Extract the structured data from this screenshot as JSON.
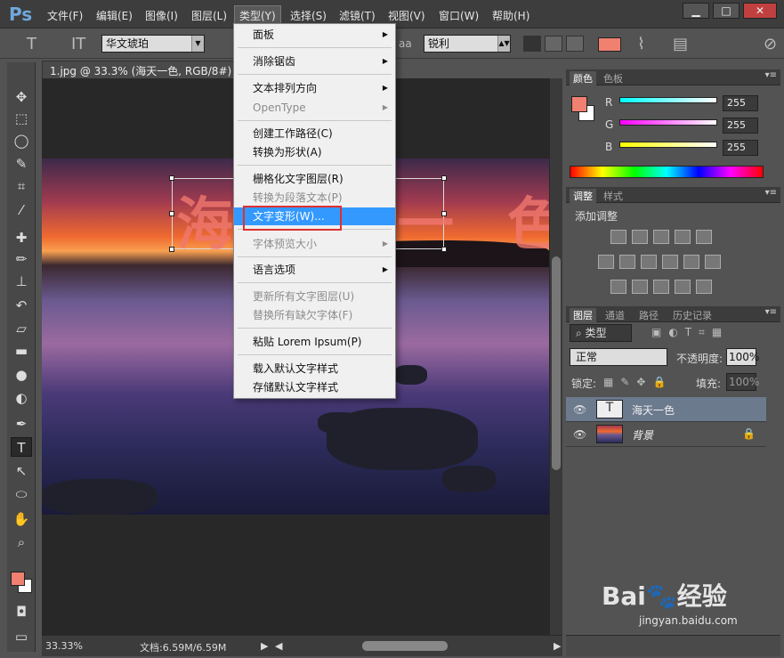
{
  "app": {
    "logo": "Ps"
  },
  "menubar": {
    "items": [
      "文件(F)",
      "编辑(E)",
      "图像(I)",
      "图层(L)",
      "类型(Y)",
      "选择(S)",
      "滤镜(T)",
      "视图(V)",
      "窗口(W)",
      "帮助(H)"
    ],
    "active": "类型(Y)"
  },
  "window_controls": {
    "minimize": "▁",
    "maximize": "□",
    "close": "✕"
  },
  "options": {
    "font_family": "华文琥珀",
    "aa_label": "aa",
    "aa_value": "锐利",
    "text_color": "#f08070"
  },
  "document": {
    "tab_title": "1.jpg @ 33.3% (海天一色, RGB/8#) *",
    "canvas_text": "海天一色",
    "zoom": "33.33%",
    "doc_size": "文档:6.59M/6.59M"
  },
  "dropdown": {
    "items": [
      {
        "label": "面板",
        "submenu": true,
        "disabled": false
      },
      {
        "label": "消除锯齿",
        "submenu": true,
        "disabled": false
      },
      {
        "label": "文本排列方向",
        "submenu": true,
        "disabled": false
      },
      {
        "label": "OpenType",
        "submenu": true,
        "disabled": true
      },
      {
        "label": "创建工作路径(C)",
        "submenu": false,
        "disabled": false
      },
      {
        "label": "转换为形状(A)",
        "submenu": false,
        "disabled": false
      },
      {
        "label": "栅格化文字图层(R)",
        "submenu": false,
        "disabled": false
      },
      {
        "label": "转换为段落文本(P)",
        "submenu": false,
        "disabled": true
      },
      {
        "label": "文字变形(W)...",
        "submenu": false,
        "disabled": false,
        "highlighted": true
      },
      {
        "label": "字体预览大小",
        "submenu": true,
        "disabled": true
      },
      {
        "label": "语言选项",
        "submenu": true,
        "disabled": false
      },
      {
        "label": "更新所有文字图层(U)",
        "submenu": false,
        "disabled": true
      },
      {
        "label": "替换所有缺欠字体(F)",
        "submenu": false,
        "disabled": true
      },
      {
        "label": "粘贴 Lorem Ipsum(P)",
        "submenu": false,
        "disabled": false
      },
      {
        "label": "载入默认文字样式",
        "submenu": false,
        "disabled": false
      },
      {
        "label": "存储默认文字样式",
        "submenu": false,
        "disabled": false
      }
    ]
  },
  "color_panel": {
    "tabs": [
      "颜色",
      "色板"
    ],
    "r_label": "R",
    "g_label": "G",
    "b_label": "B",
    "r": "255",
    "g": "255",
    "b": "255",
    "fg_color": "#f08070",
    "bg_color": "#ffffff"
  },
  "adjust_panel": {
    "tabs": [
      "调整",
      "样式"
    ],
    "heading": "添加调整"
  },
  "layers_panel": {
    "tabs": [
      "图层",
      "通道",
      "路径",
      "历史记录"
    ],
    "filter": "类型",
    "blend_mode": "正常",
    "opacity_label": "不透明度:",
    "opacity": "100%",
    "lock_label": "锁定:",
    "fill_label": "填充:",
    "fill": "100%",
    "layers": [
      {
        "name": "海天一色",
        "type": "text",
        "selected": true
      },
      {
        "name": "背景",
        "type": "image",
        "selected": false,
        "locked": true
      }
    ]
  },
  "watermark": {
    "brand": "Bai🐾经验",
    "url": "jingyan.baidu.com"
  }
}
